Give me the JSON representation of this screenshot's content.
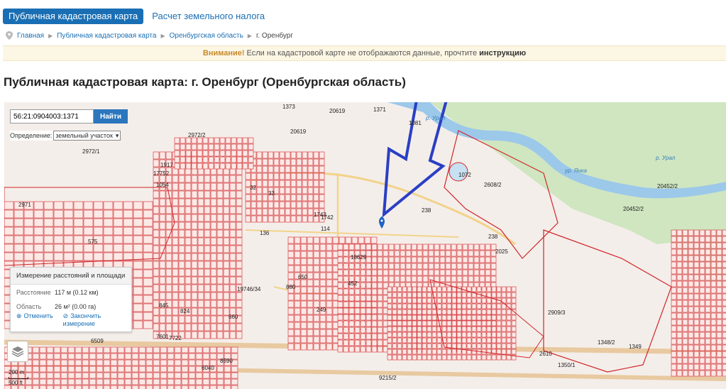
{
  "tabs": [
    {
      "label": "Публичная кадастровая карта",
      "active": true
    },
    {
      "label": "Расчет земельного налога",
      "active": false
    }
  ],
  "breadcrumb": {
    "items": [
      "Главная",
      "Публичная кадастровая карта",
      "Оренбургская область"
    ],
    "current": "г. Оренбург"
  },
  "alert": {
    "warning": "Внимание!",
    "text": "Если на кадастровой карте не отображаются данные, прочтите",
    "link": "инструкцию"
  },
  "page_title": "Публичная кадастровая карта: г. Оренбург (Оренбургская область)",
  "search": {
    "value": "56:21:0904003:1371",
    "button": "Найти"
  },
  "definition": {
    "label": "Определение:",
    "selected": "земельный участок"
  },
  "measure": {
    "title": "Измерение расстояний и площади",
    "distance_label": "Расстояние",
    "distance_value": "117 м (0.12 км)",
    "area_label": "Область",
    "area_value": "26 м² (0.00 га)",
    "cancel": "Отменить",
    "finish": "Закончить измерение"
  },
  "scale": {
    "top": "200 m",
    "bottom": "500 ft"
  },
  "map_labels": [
    "20619",
    "20619",
    "2972/2",
    "2972/1",
    "2971",
    "17752",
    "1054",
    "1917",
    "575",
    "1743",
    "1742",
    "114",
    "18629",
    "452",
    "19746/34",
    "845",
    "824",
    "660",
    "7601",
    "7722",
    "6509",
    "6040",
    "8590",
    "9215/2",
    "2610",
    "2909/3",
    "1348/2",
    "1350/1",
    "1349",
    "2608/2",
    "20452/2",
    "20452/2",
    "238",
    "2025",
    "238",
    "1072",
    "33",
    "32",
    "136",
    "650",
    "880",
    "249",
    "р. Урал",
    "р. Урал",
    "ур. Янка",
    "1081",
    "1373",
    "1371"
  ],
  "colors": {
    "accent": "#1a6fb4",
    "parcel_line": "#d0262a",
    "arrow": "#2b3fc4",
    "forest": "#cfe6c1",
    "river": "#9cc8ea"
  }
}
